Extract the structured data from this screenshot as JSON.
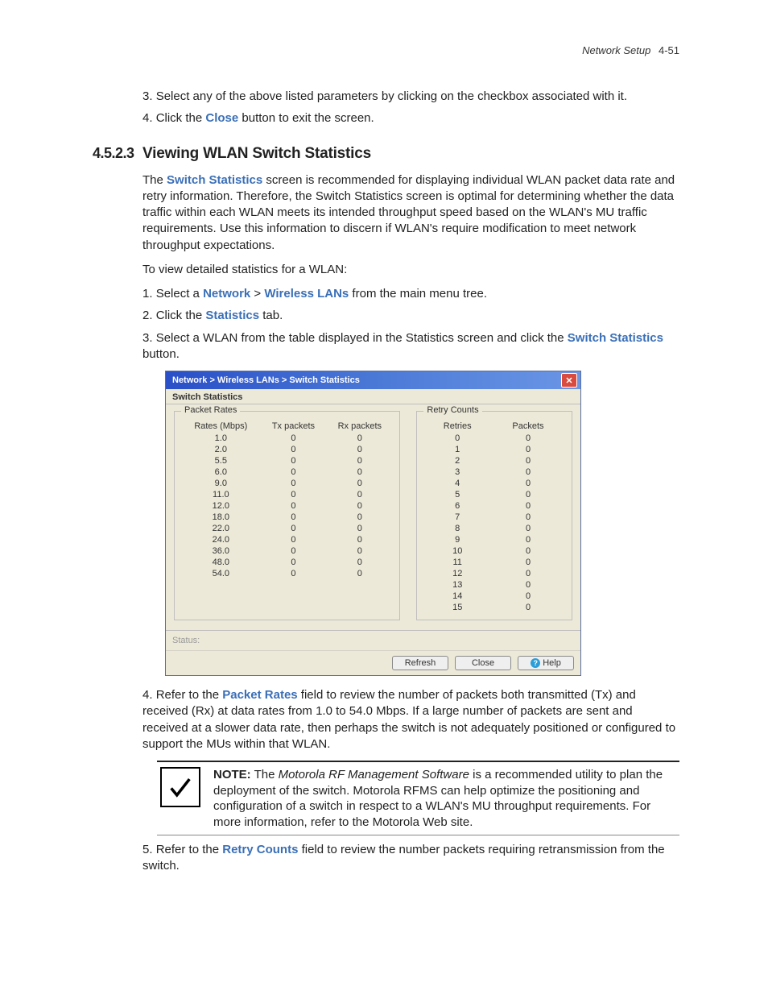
{
  "header": {
    "title": "Network Setup",
    "page": "4-51"
  },
  "top_steps": {
    "s3": "Select any of the above listed parameters by clicking on the checkbox associated with it.",
    "s4_a": "Click the ",
    "s4_b": "Close",
    "s4_c": " button to exit the screen."
  },
  "section": {
    "num": "4.5.2.3",
    "title": "Viewing WLAN Switch Statistics"
  },
  "intro": {
    "a": "The ",
    "b": "Switch Statistics",
    "c": " screen is recommended for displaying individual WLAN packet data rate and retry information. Therefore, the Switch Statistics screen is optimal for determining whether the data traffic within each WLAN meets its intended throughput speed based on the WLAN's MU traffic requirements. Use this information to discern if WLAN's require modification to meet network throughput expectations.",
    "d": "To view detailed statistics for a WLAN:"
  },
  "steps": {
    "s1_a": "Select a ",
    "s1_b": "Network",
    "s1_c": " > ",
    "s1_d": "Wireless LANs",
    "s1_e": " from the main menu tree.",
    "s2_a": "Click the ",
    "s2_b": "Statistics",
    "s2_c": " tab.",
    "s3_a": "Select a WLAN from the table displayed in the Statistics screen and click the ",
    "s3_b": "Switch Statistics",
    "s3_c": " button.",
    "s4_a": "Refer to the ",
    "s4_b": "Packet Rates",
    "s4_c": " field to review the number of packets both transmitted (Tx) and received (Rx) at data rates from 1.0 to 54.0 Mbps. If a large number of packets are sent and received at a slower data rate, then perhaps the switch is not adequately positioned or configured to support the MUs within that WLAN.",
    "s5_a": "Refer to the ",
    "s5_b": "Retry Counts",
    "s5_c": " field to review the number packets requiring retransmission from the switch."
  },
  "dialog": {
    "breadcrumb": "Network > Wireless LANs > Switch Statistics",
    "subtitle": "Switch Statistics",
    "rates_legend": "Packet Rates",
    "rates_headers": {
      "c1": "Rates (Mbps)",
      "c2": "Tx packets",
      "c3": "Rx packets"
    },
    "rates_rows": [
      {
        "r": "1.0",
        "tx": "0",
        "rx": "0"
      },
      {
        "r": "2.0",
        "tx": "0",
        "rx": "0"
      },
      {
        "r": "5.5",
        "tx": "0",
        "rx": "0"
      },
      {
        "r": "6.0",
        "tx": "0",
        "rx": "0"
      },
      {
        "r": "9.0",
        "tx": "0",
        "rx": "0"
      },
      {
        "r": "11.0",
        "tx": "0",
        "rx": "0"
      },
      {
        "r": "12.0",
        "tx": "0",
        "rx": "0"
      },
      {
        "r": "18.0",
        "tx": "0",
        "rx": "0"
      },
      {
        "r": "22.0",
        "tx": "0",
        "rx": "0"
      },
      {
        "r": "24.0",
        "tx": "0",
        "rx": "0"
      },
      {
        "r": "36.0",
        "tx": "0",
        "rx": "0"
      },
      {
        "r": "48.0",
        "tx": "0",
        "rx": "0"
      },
      {
        "r": "54.0",
        "tx": "0",
        "rx": "0"
      }
    ],
    "retry_legend": "Retry Counts",
    "retry_headers": {
      "c1": "Retries",
      "c2": "Packets"
    },
    "retry_rows": [
      {
        "r": "0",
        "p": "0"
      },
      {
        "r": "1",
        "p": "0"
      },
      {
        "r": "2",
        "p": "0"
      },
      {
        "r": "3",
        "p": "0"
      },
      {
        "r": "4",
        "p": "0"
      },
      {
        "r": "5",
        "p": "0"
      },
      {
        "r": "6",
        "p": "0"
      },
      {
        "r": "7",
        "p": "0"
      },
      {
        "r": "8",
        "p": "0"
      },
      {
        "r": "9",
        "p": "0"
      },
      {
        "r": "10",
        "p": "0"
      },
      {
        "r": "11",
        "p": "0"
      },
      {
        "r": "12",
        "p": "0"
      },
      {
        "r": "13",
        "p": "0"
      },
      {
        "r": "14",
        "p": "0"
      },
      {
        "r": "15",
        "p": "0"
      }
    ],
    "status_label": "Status:",
    "buttons": {
      "refresh": "Refresh",
      "close": "Close",
      "help": "Help"
    }
  },
  "note": {
    "lead": "NOTE:",
    "a": " The ",
    "b": "Motorola RF Management Software",
    "c": " is a recommended utility to plan the deployment of the switch. Motorola RFMS can help optimize the positioning and configuration of a switch in respect to a WLAN's MU throughput requirements. For more information, refer to the Motorola Web site."
  }
}
